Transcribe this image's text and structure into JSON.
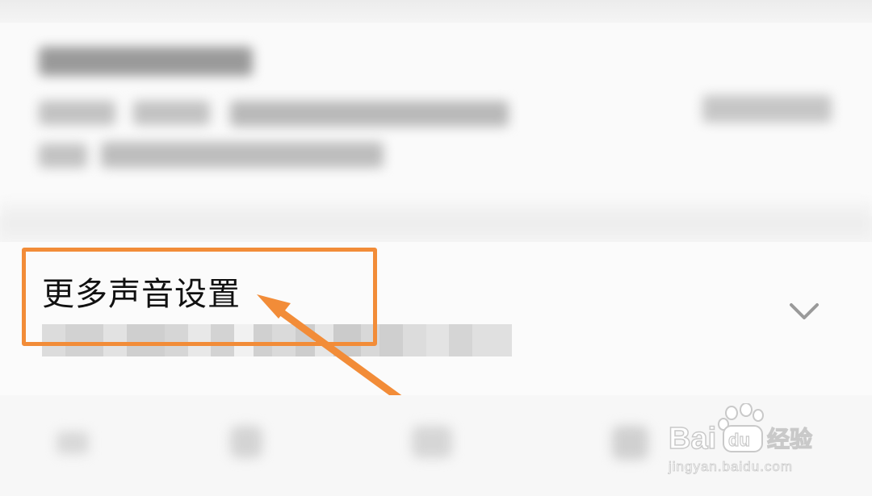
{
  "sound_settings": {
    "title": "更多声音设置",
    "subtitle_obscured": true
  },
  "colors": {
    "highlight": "#f28c38",
    "arrow": "#f28c38"
  },
  "icons": {
    "expand": "chevron-down-icon"
  },
  "watermark": {
    "brand_text": "Bai du经验",
    "url": "jingyan.baidu.com"
  }
}
